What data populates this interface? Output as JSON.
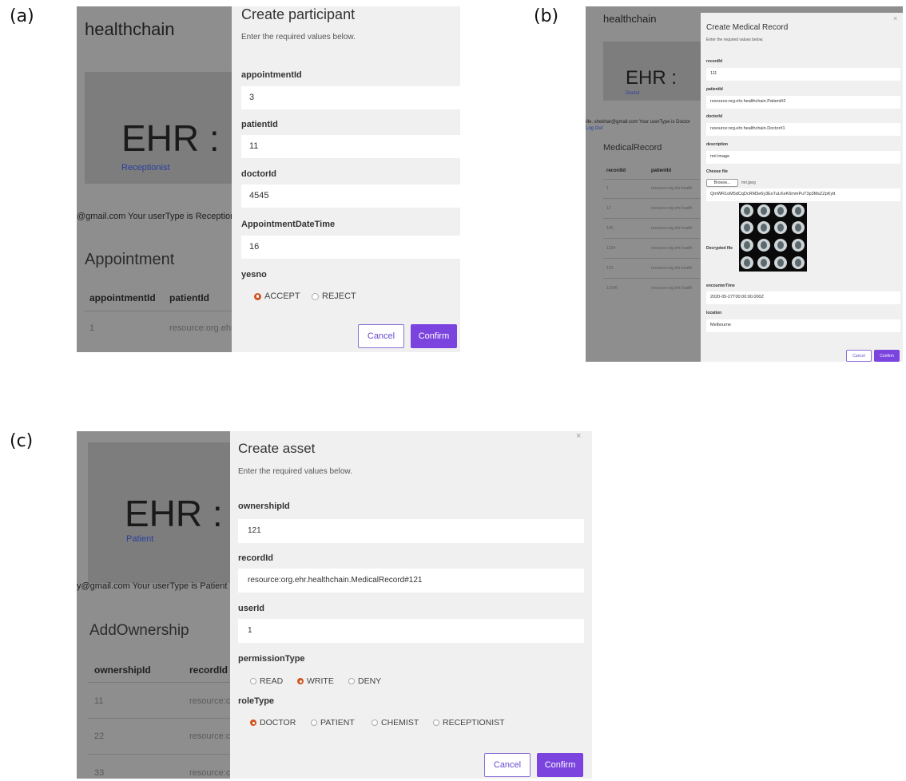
{
  "labels": {
    "a": "(a)",
    "b": "(b)",
    "c": "(c)"
  },
  "a": {
    "bg": {
      "title": "healthchain",
      "ehr": "EHR :",
      "role": "Receptionist",
      "email": "@gmail.com Your userType is Reception",
      "heading": "Appointment",
      "col1": "appointmentId",
      "col2": "patientId",
      "row1_id": "1",
      "row1_pid": "resource:org.ehr"
    },
    "modal": {
      "title": "Create participant",
      "subtitle": "Enter the required values below.",
      "fields": [
        {
          "label": "appointmentId",
          "value": "3"
        },
        {
          "label": "patientId",
          "value": "11"
        },
        {
          "label": "doctorId",
          "value": "4545"
        },
        {
          "label": "AppointmentDateTime",
          "value": "16"
        }
      ],
      "radio_label": "yesno",
      "radio_options": [
        "ACCEPT",
        "REJECT"
      ],
      "cancel": "Cancel",
      "confirm": "Confirm"
    }
  },
  "b": {
    "bg": {
      "title": "healthchain",
      "ehr": "EHR :",
      "role": "Doctor",
      "email": "ille. shekhar@gmail.com Your userType is Doctor",
      "logout": "Log Out",
      "heading": "MedicalRecord",
      "col1": "recordId",
      "col2": "patientId",
      "rows": [
        {
          "id": "1",
          "pid": "resource:org.ehr.health"
        },
        {
          "id": "12",
          "pid": "resource:org.ehr.health"
        },
        {
          "id": "145",
          "pid": "resource:org.ehr.health"
        },
        {
          "id": "1234",
          "pid": "resource:org.ehr.health"
        },
        {
          "id": "123",
          "pid": "resource:org.ehr.health"
        },
        {
          "id": "12345",
          "pid": "resource:org.ehr.health"
        }
      ]
    },
    "modal": {
      "title": "Create Medical Record",
      "subtitle": "Enter the required values below.",
      "close": "×",
      "fields": [
        {
          "label": "recordId",
          "value": "111"
        },
        {
          "label": "patientId",
          "value": "resource:org.ehr.healthchain.Patient#2"
        },
        {
          "label": "doctorId",
          "value": "resource:org.ehr.healthchain.Doctor#1"
        },
        {
          "label": "description",
          "value": "mri image"
        }
      ],
      "file_label": "Choose file",
      "browse": "Browse...",
      "file_name": "mri.jpeg",
      "hash": "QmWR1oM5dCqDcRM3e6y3EsTuLKeK6mmPuT3p3MsZZpKytt",
      "decrypted_label": "Decrypted file",
      "encounter_label": "encounterTime",
      "encounter_value": "2020-05-27T00:00:00.000Z",
      "location_label": "location",
      "location_value": "Melbourne",
      "cancel": "Cancel",
      "confirm": "Confirm"
    }
  },
  "c": {
    "bg": {
      "ehr": "EHR :",
      "role": "Patient",
      "email": "y@gmail.com Your userType is Patient",
      "heading": "AddOwnership",
      "col1": "ownershipId",
      "col2": "recordId",
      "rows": [
        {
          "id": "11",
          "rid": "resource:c"
        },
        {
          "id": "22",
          "rid": "resource:c"
        },
        {
          "id": "33",
          "rid": "resource:c"
        }
      ]
    },
    "modal": {
      "title": "Create asset",
      "subtitle": "Enter the required values below.",
      "close": "×",
      "fields": [
        {
          "label": "ownershipId",
          "value": "121"
        },
        {
          "label": "recordId",
          "value": "resource:org.ehr.healthchain.MedicalRecord#121"
        },
        {
          "label": "userId",
          "value": "1"
        }
      ],
      "perm_label": "permissionType",
      "perm_options": [
        "READ",
        "WRITE",
        "DENY"
      ],
      "role_label": "roleType",
      "role_options": [
        "DOCTOR",
        "PATIENT",
        "CHEMIST",
        "RECEPTIONIST"
      ],
      "cancel": "Cancel",
      "confirm": "Confirm"
    }
  }
}
